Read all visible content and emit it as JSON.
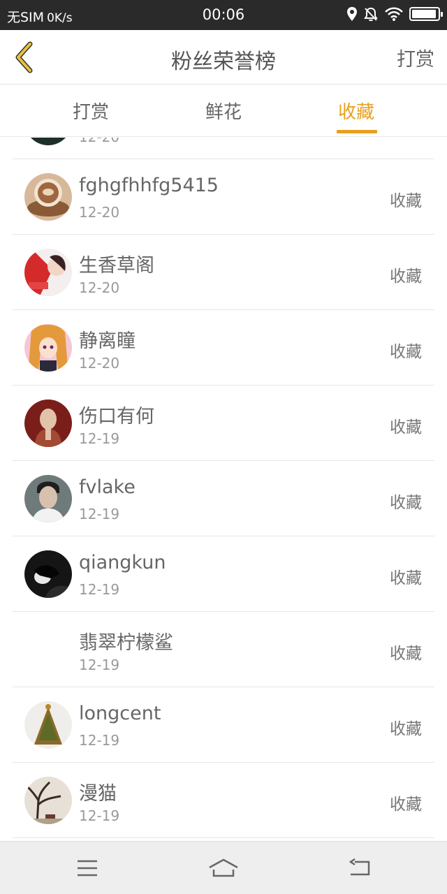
{
  "status_bar": {
    "carrier": "无SIM",
    "speed": "0K/s",
    "time": "00:06",
    "battery_level": 0.95
  },
  "header": {
    "title": "粉丝荣誉榜",
    "right_action": "打赏"
  },
  "tabs": [
    {
      "label": "打赏",
      "active": false
    },
    {
      "label": "鲜花",
      "active": false
    },
    {
      "label": "收藏",
      "active": true
    }
  ],
  "list": {
    "partial_top": {
      "date": "12-20"
    },
    "items": [
      {
        "name": "fghgfhhfg5415",
        "date": "12-20",
        "action": "收藏"
      },
      {
        "name": "生香草阁",
        "date": "12-20",
        "action": "收藏"
      },
      {
        "name": "静离瞳",
        "date": "12-20",
        "action": "收藏"
      },
      {
        "name": "伤口有何",
        "date": "12-19",
        "action": "收藏"
      },
      {
        "name": "fvlake",
        "date": "12-19",
        "action": "收藏"
      },
      {
        "name": "qiangkun",
        "date": "12-19",
        "action": "收藏"
      },
      {
        "name": "翡翠柠檬鲨",
        "date": "12-19",
        "action": "收藏"
      },
      {
        "name": "longcent",
        "date": "12-19",
        "action": "收藏"
      },
      {
        "name": "漫猫",
        "date": "12-19",
        "action": "收藏"
      }
    ]
  },
  "colors": {
    "accent": "#e8a020",
    "back_icon": "#d4a82a"
  },
  "icons": {
    "back": "chevron-left-icon",
    "location": "location-icon",
    "mute": "bell-off-icon",
    "wifi": "wifi-icon",
    "battery": "battery-icon",
    "menu": "menu-icon",
    "home": "home-icon",
    "return": "back-arrow-icon"
  }
}
